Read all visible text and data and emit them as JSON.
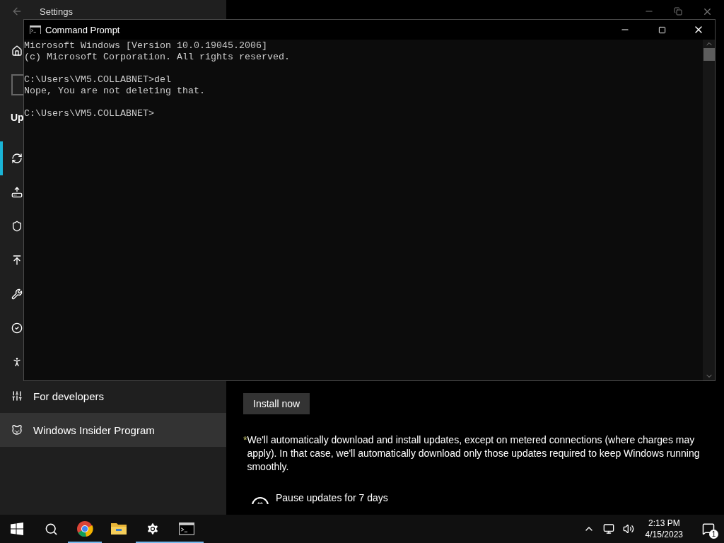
{
  "settings": {
    "title": "Settings",
    "sidebar": {
      "heading": "Up",
      "items": [
        {
          "selected": true,
          "hovered": false
        },
        {
          "selected": false,
          "hovered": false
        },
        {
          "selected": false,
          "hovered": false
        },
        {
          "selected": false,
          "hovered": false
        },
        {
          "selected": false,
          "hovered": false
        },
        {
          "selected": false,
          "hovered": false
        },
        {
          "selected": false,
          "hovered": false
        },
        {
          "label": "For developers",
          "selected": false,
          "hovered": false
        },
        {
          "label": "Windows Insider Program",
          "selected": false,
          "hovered": true
        }
      ]
    },
    "content": {
      "button": "Install now",
      "note": {
        "marker": "*",
        "text": "We'll automatically download and install updates, except on metered connections (where charges may apply). In that case, we'll automatically download only those updates required to keep Windows running smoothly."
      },
      "pause": "Pause updates for 7 days"
    }
  },
  "cmd": {
    "title": "Command Prompt",
    "blocks": [
      [
        "Microsoft Windows [Version 10.0.19045.2006]",
        "(c) Microsoft Corporation. All rights reserved."
      ],
      [
        "C:\\Users\\VM5.COLLABNET>del",
        "Nope, You are not deleting that."
      ],
      [
        "C:\\Users\\VM5.COLLABNET>"
      ]
    ]
  },
  "taskbar": {
    "apps": [
      {
        "kind": "start",
        "running": false
      },
      {
        "kind": "search",
        "running": false
      },
      {
        "kind": "browser",
        "running": true
      },
      {
        "kind": "folder",
        "running": false
      },
      {
        "kind": "settings",
        "running": true
      },
      {
        "kind": "terminal",
        "running": true
      }
    ],
    "clock": {
      "time": "2:13 PM",
      "date": "4/15/2023"
    },
    "notifications": "1"
  }
}
